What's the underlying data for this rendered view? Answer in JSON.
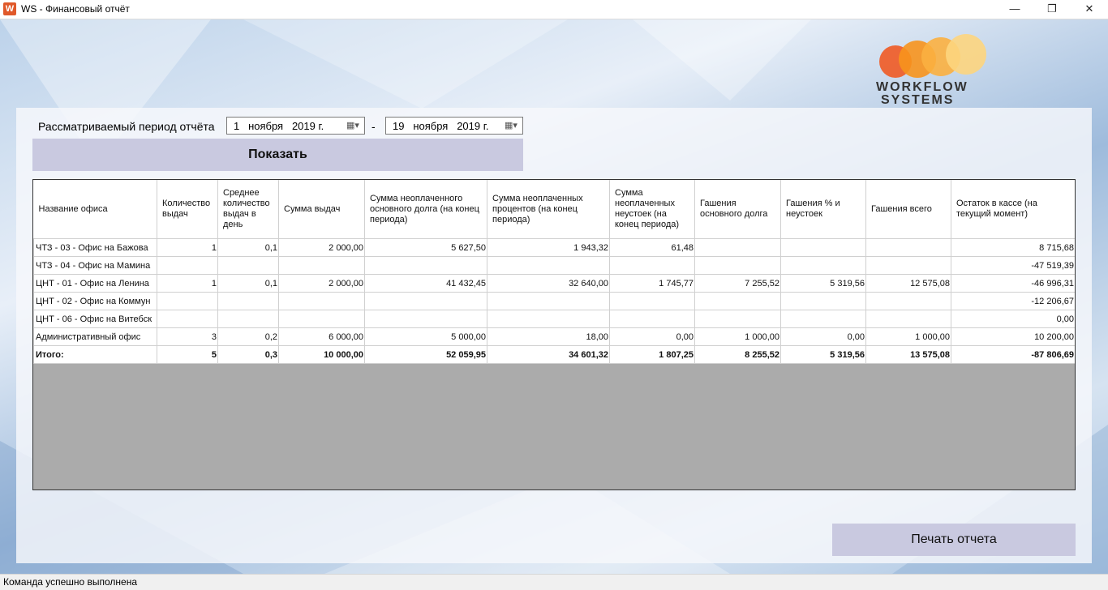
{
  "window": {
    "title": "WS - Финансовый отчёт",
    "icon_letter": "W",
    "minimize_glyph": "—",
    "maximize_glyph": "❐",
    "close_glyph": "✕"
  },
  "logo": {
    "line1": "WORKFLOW",
    "line2": "SYSTEMS",
    "colors": [
      "#f05a23",
      "#f7941d",
      "#fbb040",
      "#fdd57e"
    ]
  },
  "filter": {
    "period_label": "Рассматриваемый период отчёта",
    "date_from": {
      "day": "1",
      "month": "ноября",
      "year": "2019 г."
    },
    "separator": "-",
    "date_to": {
      "day": "19",
      "month": "ноября",
      "year": "2019 г."
    },
    "show_button": "Показать"
  },
  "table": {
    "columns": [
      "Название офиса",
      "Количество выдач",
      "Среднее количество выдач в день",
      "Сумма выдач",
      "Сумма неоплаченного основного долга (на конец периода)",
      "Сумма неоплаченных процентов (на конец периода)",
      "Сумма неоплаченных неустоек (на конец периода)",
      "Гашения основного долга",
      "Гашения % и неустоек",
      "Гашения всего",
      "Остаток в кассе (на текущий момент)"
    ],
    "rows": [
      [
        "ЧТЗ - 03 - Офис на Бажова",
        "1",
        "0,1",
        "2 000,00",
        "5 627,50",
        "1 943,32",
        "61,48",
        "",
        "",
        "",
        "8 715,68"
      ],
      [
        "ЧТЗ - 04 - Офис на Мамина",
        "",
        "",
        "",
        "",
        "",
        "",
        "",
        "",
        "",
        "-47 519,39"
      ],
      [
        "ЦНТ - 01 - Офис на Ленина",
        "1",
        "0,1",
        "2 000,00",
        "41 432,45",
        "32 640,00",
        "1 745,77",
        "7 255,52",
        "5 319,56",
        "12 575,08",
        "-46 996,31"
      ],
      [
        "ЦНТ - 02 - Офис на Коммун",
        "",
        "",
        "",
        "",
        "",
        "",
        "",
        "",
        "",
        "-12 206,67"
      ],
      [
        "ЦНТ - 06 - Офис на Витебск",
        "",
        "",
        "",
        "",
        "",
        "",
        "",
        "",
        "",
        "0,00"
      ],
      [
        "Административный офис",
        "3",
        "0,2",
        "6 000,00",
        "5 000,00",
        "18,00",
        "0,00",
        "1 000,00",
        "0,00",
        "1 000,00",
        "10 200,00"
      ]
    ],
    "total": [
      "Итого:",
      "5",
      "0,3",
      "10 000,00",
      "52 059,95",
      "34 601,32",
      "1 807,25",
      "8 255,52",
      "5 319,56",
      "13 575,08",
      "-87 806,69"
    ]
  },
  "print_button": "Печать отчета",
  "status": "Команда успешно выполнена"
}
